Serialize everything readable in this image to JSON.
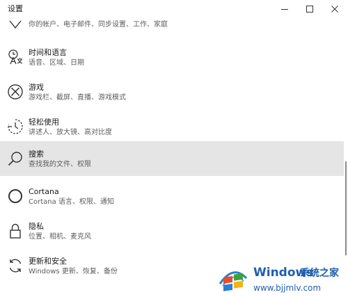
{
  "window": {
    "title": "设置"
  },
  "items": [
    {
      "label": "",
      "desc": "你的帐户、电子邮件、同步设置、工作、家庭",
      "icon": "account-icon"
    },
    {
      "label": "时间和语言",
      "desc": "语音、区域、日期",
      "icon": "time-language-icon"
    },
    {
      "label": "游戏",
      "desc": "游戏栏、截屏、直播、游戏模式",
      "icon": "xbox-icon"
    },
    {
      "label": "轻松使用",
      "desc": "讲述人、放大镜、高对比度",
      "icon": "ease-of-access-icon"
    },
    {
      "label": "搜索",
      "desc": "查找我的文件、权限",
      "icon": "search-icon"
    },
    {
      "label": "Cortana",
      "desc": "Cortana 语言、权限、通知",
      "icon": "cortana-icon"
    },
    {
      "label": "隐私",
      "desc": "位置、相机、麦克风",
      "icon": "lock-icon"
    },
    {
      "label": "更新和安全",
      "desc": "Windows 更新、恢复、备份",
      "icon": "update-icon"
    }
  ],
  "watermark": {
    "title": "Windows",
    "subtitle": "系统之家",
    "url": "www.bjjmlv.com"
  },
  "colors": {
    "selected_bg": "#e5e5e5",
    "watermark_blue": "#1f5fb0"
  }
}
